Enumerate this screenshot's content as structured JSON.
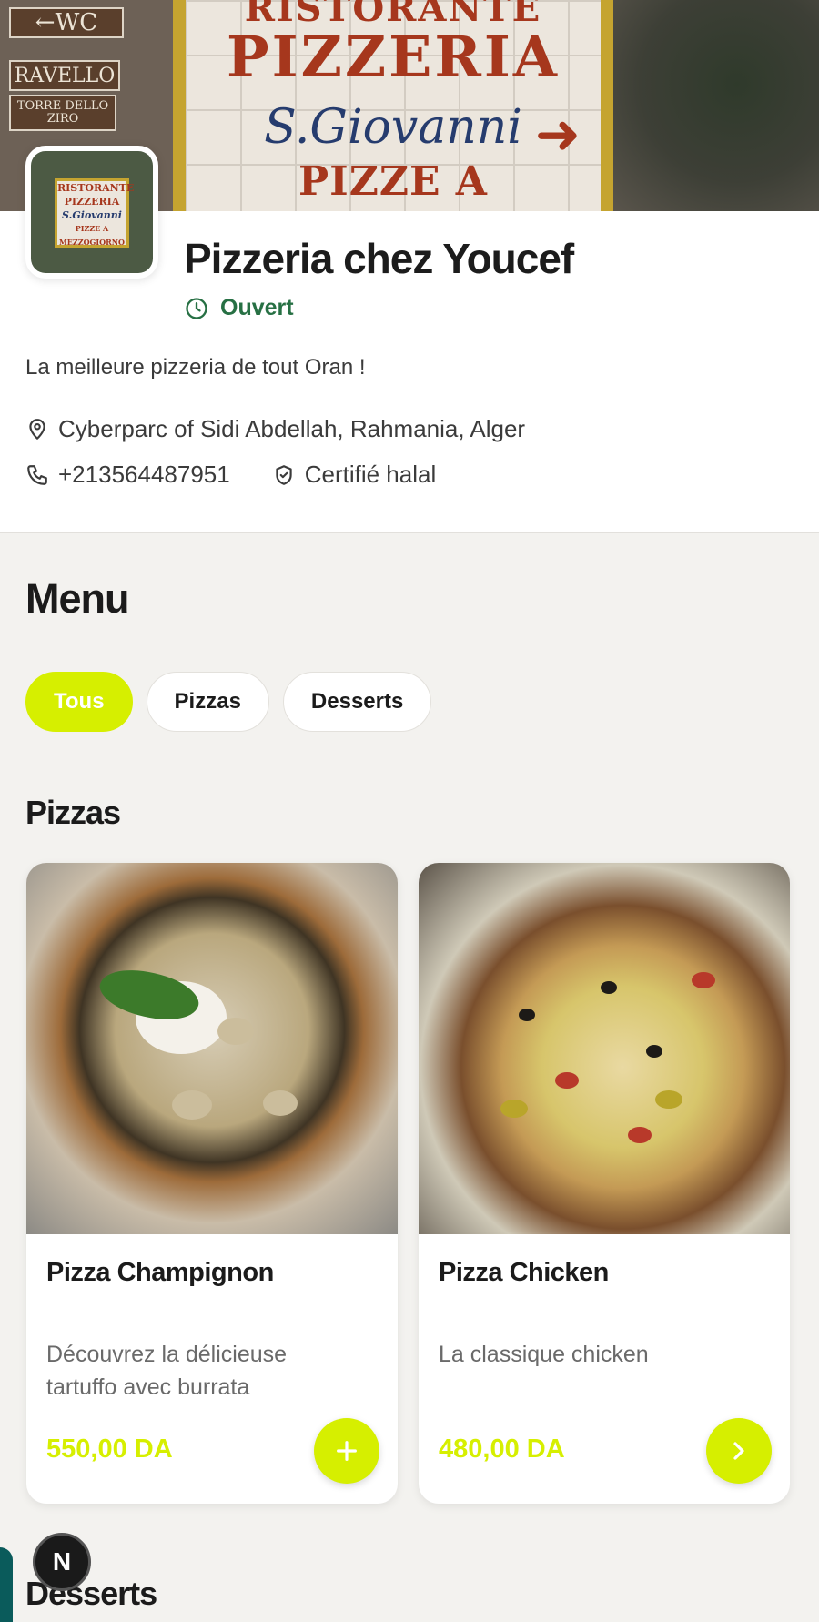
{
  "hero": {
    "left_signs": [
      "←WC",
      "RAVELLO",
      "TORRE DELLO ZIRO"
    ],
    "tile_lines": [
      "RISTORANTE",
      "PIZZERIA",
      "S.Giovanni",
      "PIZZE A MEZZOGIORNO"
    ],
    "arrow": "➜"
  },
  "avatar": {
    "lines": [
      "RISTORANTE",
      "PIZZERIA",
      "S.Giovanni",
      "PIZZE A MEZZOGIORNO"
    ]
  },
  "restaurant": {
    "name": "Pizzeria chez Youcef",
    "status": "Ouvert",
    "description": "La meilleure pizzeria de tout Oran !",
    "address": "Cyberparc of Sidi Abdellah, Rahmania, Alger",
    "phone": "+213564487951",
    "certification": "Certifié halal"
  },
  "menu": {
    "title": "Menu",
    "filters": [
      {
        "label": "Tous",
        "active": true
      },
      {
        "label": "Pizzas",
        "active": false
      },
      {
        "label": "Desserts",
        "active": false
      }
    ],
    "sections": [
      {
        "title": "Pizzas",
        "items": [
          {
            "name": "Pizza Champignon",
            "description": "Découvrez la délicieuse tartuffo avec burrata",
            "price": "550,00 DA",
            "action_icon": "plus-icon"
          },
          {
            "name": "Pizza Chicken",
            "description": "La classique chicken",
            "price": "480,00 DA",
            "action_icon": "chevron-right-icon"
          }
        ]
      },
      {
        "title": "Desserts",
        "items": []
      }
    ]
  },
  "dev_badge": {
    "label": "N"
  },
  "colors": {
    "accent": "#d6ef00",
    "status_open": "#277044",
    "background": "#f3f2ef"
  }
}
